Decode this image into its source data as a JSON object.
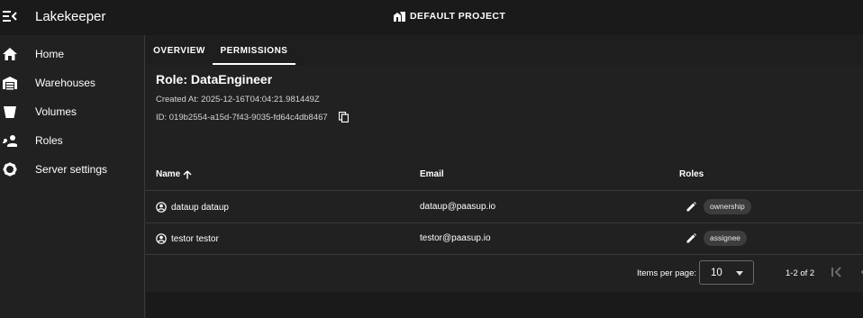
{
  "app": {
    "title": "Lakekeeper",
    "project": "DEFAULT PROJECT"
  },
  "sidebar": {
    "items": [
      {
        "label": "Home",
        "icon": "home-icon"
      },
      {
        "label": "Warehouses",
        "icon": "warehouse-icon"
      },
      {
        "label": "Volumes",
        "icon": "bucket-icon"
      },
      {
        "label": "Roles",
        "icon": "people-icon"
      },
      {
        "label": "Server settings",
        "icon": "gear-icon"
      }
    ]
  },
  "tabs": [
    {
      "label": "OVERVIEW",
      "active": false
    },
    {
      "label": "PERMISSIONS",
      "active": true
    }
  ],
  "role": {
    "title": "Role: DataEngineer",
    "created_at": "Created At: 2025-12-16T04:04:21.981449Z",
    "id": "ID: 019b2554-a15d-7f43-9035-fd64c4db8467"
  },
  "table": {
    "columns": [
      "Name",
      "Email",
      "Roles"
    ],
    "rows": [
      {
        "name": "dataup dataup",
        "email": "dataup@paasup.io",
        "role": "ownership"
      },
      {
        "name": "testor testor",
        "email": "testor@paasup.io",
        "role": "assignee"
      }
    ]
  },
  "pagination": {
    "items_per_page_label": "Items per page:",
    "items_per_page": "10",
    "range": "1-2 of 2"
  },
  "colors": {
    "background": "#212121",
    "topbar": "#1a1a1a",
    "chip": "#3d3d3d"
  }
}
